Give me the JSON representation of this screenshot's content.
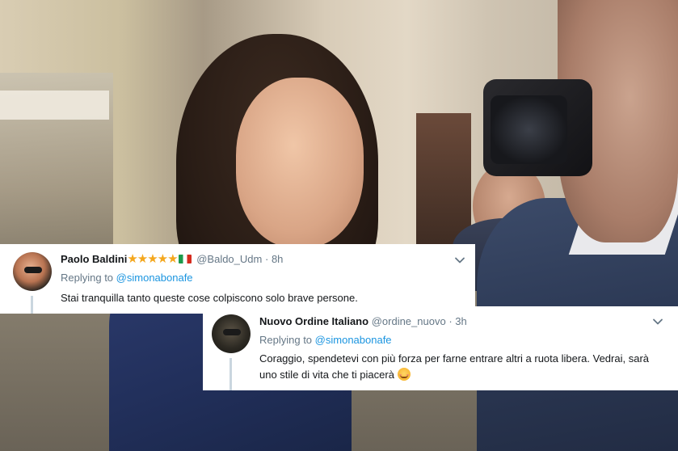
{
  "tweets": [
    {
      "name": "Paolo Baldini",
      "stars": "★★★★★",
      "handle": "@Baldo_Udm",
      "separator": "·",
      "time": "8h",
      "replying_prefix": "Replying to",
      "replying_to": "@simonabonafe",
      "text": "Stai tranquilla tanto queste cose colpiscono solo brave persone.",
      "flag_icon": "italy-flag-icon",
      "menu_icon": "chevron-down-icon"
    },
    {
      "name": "Nuovo Ordine Italiano",
      "handle": "@ordine_nuovo",
      "separator": "·",
      "time": "3h",
      "replying_prefix": "Replying to",
      "replying_to": "@simonabonafe",
      "text": "Coraggio, spendetevi con più forza per farne entrare altri a ruota libera. Vedrai, sarà uno stile di vita che ti piacerà",
      "emoji_icon": "smiling-blush-emoji-icon",
      "menu_icon": "chevron-down-icon"
    }
  ],
  "colors": {
    "link": "#1b95e0",
    "secondary_text": "#657786",
    "primary_text": "#14171a",
    "stars": "#f4a71d"
  }
}
